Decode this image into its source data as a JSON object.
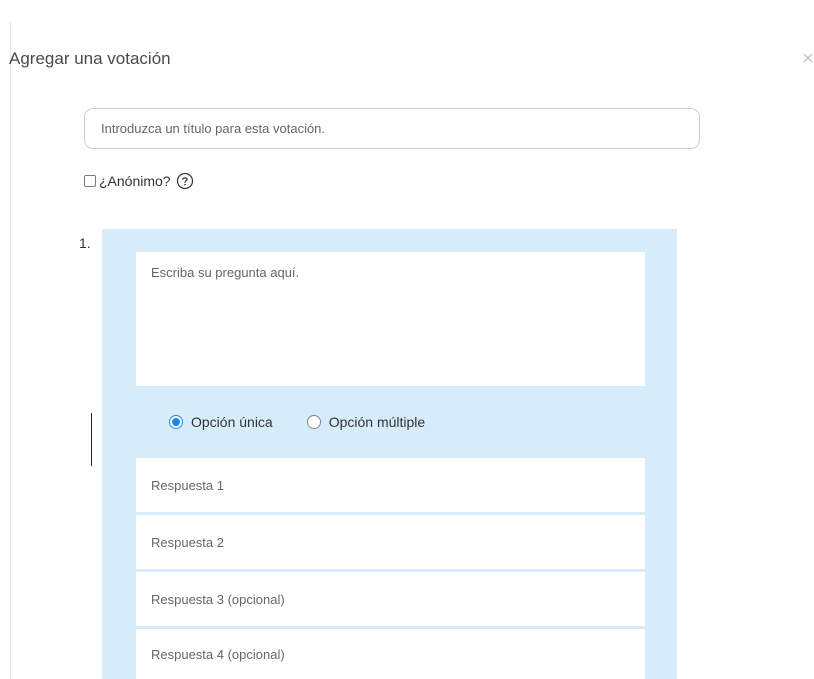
{
  "dialog": {
    "title": "Agregar una votación",
    "close_icon": "close-icon"
  },
  "poll": {
    "title_placeholder": "Introduzca un título para esta votación.",
    "anonymous_label": "¿Anónimo?",
    "anonymous_checked": false,
    "help_icon": "question-circle-icon"
  },
  "question": {
    "number": "1.",
    "placeholder": "Escriba su pregunta aquí.",
    "type_options": [
      {
        "label": "Opción única",
        "selected": true
      },
      {
        "label": "Opción múltiple",
        "selected": false
      }
    ],
    "answers": [
      {
        "placeholder": "Respuesta 1"
      },
      {
        "placeholder": "Respuesta 2"
      },
      {
        "placeholder": "Respuesta 3 (opcional)"
      },
      {
        "placeholder": "Respuesta 4 (opcional)"
      }
    ]
  },
  "colors": {
    "panel_background": "#d6ecfa",
    "radio_accent": "#1e88e5"
  }
}
